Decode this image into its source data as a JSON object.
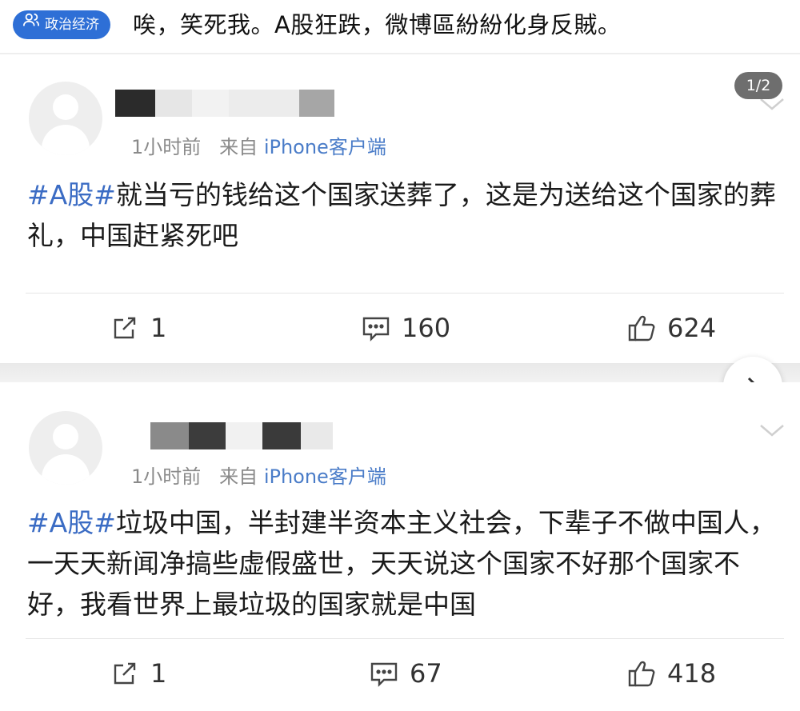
{
  "header": {
    "tag_label": "政治经济",
    "title": "唉，笑死我。A股狂跌，微博區紛紛化身反賊。"
  },
  "pager": {
    "text": "1/2"
  },
  "posts": [
    {
      "meta_time": "1小时前",
      "meta_from": "来自",
      "meta_client": "iPhone客户端",
      "hashtag": "#A股#",
      "text": "就当亏的钱给这个国家送葬了，这是为送给这个国家的葬礼，中国赶紧死吧",
      "reposts": "1",
      "comments": "160",
      "likes": "624"
    },
    {
      "meta_time": "1小时前",
      "meta_from": "来自",
      "meta_client": "iPhone客户端",
      "hashtag": "#A股#",
      "text": "垃圾中国，半封建半资本主义社会，下辈子不做中国人，一天天新闻净搞些虚假盛世，天天说这个国家不好那个国家不好，我看世界上最垃圾的国家就是中国",
      "reposts": "1",
      "comments": "67",
      "likes": "418"
    }
  ],
  "icons": {
    "tag": "group-chat-icon",
    "repost": "repost-icon",
    "comment": "comment-icon",
    "like": "thumbs-up-icon",
    "next": "chevron-right-icon",
    "expand": "chevron-down-icon"
  },
  "colors": {
    "tag_bg": "#2e6fd6",
    "hashtag": "#3b6cc4",
    "meta": "#8a8a8a"
  }
}
